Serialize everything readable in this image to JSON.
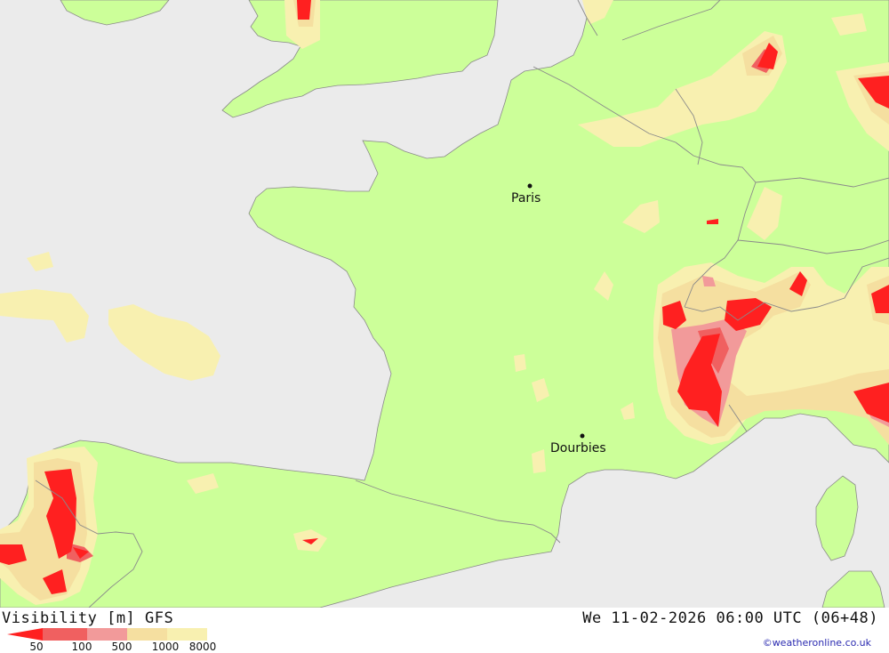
{
  "map": {
    "colors": {
      "sea": "#ebebeb",
      "land": "#ccff99",
      "border": "#8a8a8a",
      "vis_50": "#ff2020",
      "vis_100": "#f06060",
      "vis_500": "#f29a9a",
      "vis_1000": "#f5dfa0",
      "vis_8000": "#f8f0b0"
    },
    "cities": [
      {
        "name": "Paris"
      },
      {
        "name": "Dourbies"
      }
    ]
  },
  "footer": {
    "title_left": "Visibility [m] GFS",
    "title_right": "We 11-02-2026 06:00 UTC (06+48)",
    "credit": "©weatheronline.co.uk"
  },
  "legend": {
    "labels": [
      "50",
      "100",
      "500",
      "1000",
      "8000"
    ],
    "colors": [
      "#ff2020",
      "#f06060",
      "#f29a9a",
      "#f5dfa0",
      "#f8f0b0"
    ]
  }
}
